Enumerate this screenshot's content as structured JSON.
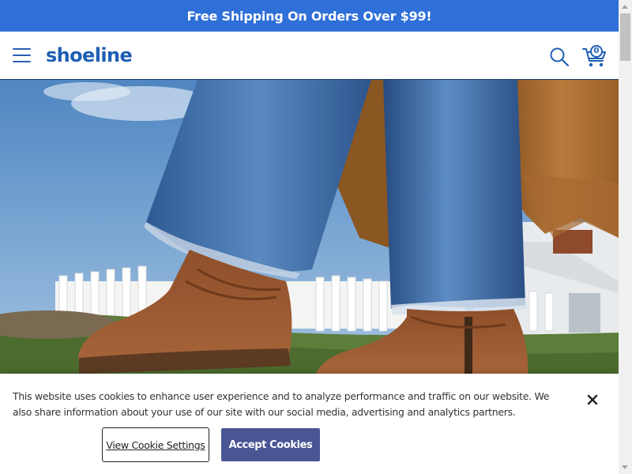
{
  "promo": {
    "text": "Free Shipping On Orders Over $99!"
  },
  "header": {
    "logo": "shoeline",
    "cart_count": "0",
    "icons": {
      "menu": "hamburger-menu-icon",
      "search": "search-icon",
      "cart": "cart-icon"
    }
  },
  "hero": {
    "image_alt": "Person in frayed wide-leg jeans and a camel coat walking in brown suede ankle boots on grass near a white picket fence"
  },
  "cookie_banner": {
    "message": "This website uses cookies to enhance user experience and to analyze performance and traffic on our website. We also share information about your use of our site with our social media, advertising and analytics partners.",
    "settings_label": "View Cookie Settings",
    "accept_label": "Accept Cookies",
    "close_icon": "close-icon"
  },
  "colors": {
    "promo_bg": "#2f6fd8",
    "brand_blue": "#1f5fb4",
    "accept_bg": "#4a5594",
    "text": "#333333"
  }
}
